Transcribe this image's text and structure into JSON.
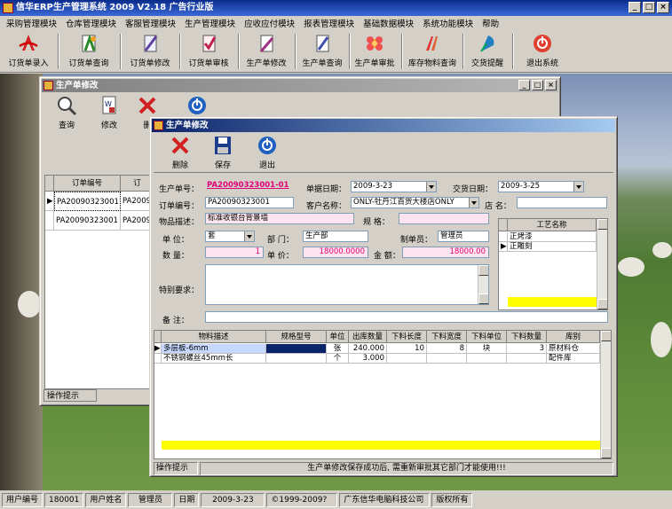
{
  "app": {
    "title": "信华ERP生产管理系统  2009  V2.18  广告行业版"
  },
  "menu": [
    "采购管理模块",
    "仓库管理模块",
    "客服管理模块",
    "生产管理模块",
    "应收应付模块",
    "报表管理模块",
    "基础数据模块",
    "系统功能模块",
    "帮助"
  ],
  "toolbar": [
    {
      "label": "订货单录入",
      "icon": "pdf-icon"
    },
    {
      "label": "订货单查询",
      "icon": "document-query-icon"
    },
    {
      "label": "订货单修改",
      "icon": "document-edit-icon"
    },
    {
      "label": "订货单审核",
      "icon": "document-audit-icon"
    },
    {
      "label": "生产单修改",
      "icon": "production-edit-icon"
    },
    {
      "label": "生产单查询",
      "icon": "production-query-icon"
    },
    {
      "label": "生产单审批",
      "icon": "flower-approve-icon"
    },
    {
      "label": "库存物料查询",
      "icon": "stock-query-icon"
    },
    {
      "label": "交货提醒",
      "icon": "delivery-reminder-icon"
    },
    {
      "label": "退出系统",
      "icon": "power-icon"
    }
  ],
  "back_window": {
    "title": "生产单修改",
    "buttons": {
      "query": "查询",
      "edit": "修改",
      "delete": "删"
    },
    "grid_header": "订单编号",
    "grid_header2": "订",
    "rows": [
      {
        "a": "PA20090323001",
        "b": "PA200903"
      },
      {
        "a": "PA20090323001",
        "b": "PA200903"
      }
    ],
    "footer": "操作提示"
  },
  "front_window": {
    "title": "生产单修改",
    "buttons": {
      "delete": "删除",
      "save": "保存",
      "exit": "退出"
    },
    "labels": {
      "prod_no": "生产单号：",
      "doc_date": "单据日期：",
      "delivery_date": "交货日期：",
      "order_no": "订单编号：",
      "customer": "客户名称：",
      "shop": "店  名：",
      "desc": "物品描述：",
      "spec": "规  格：",
      "unit": "单  位：",
      "dept": "部  门：",
      "maker": "制单员：",
      "qty": "数  量：",
      "price": "单  价：",
      "amount": "金  额：",
      "special": "特别要求：",
      "remark": "备  注："
    },
    "values": {
      "prod_no": "PA20090323001-01",
      "doc_date": "2009-3-23",
      "delivery_date": "2009-3-25",
      "order_no": "PA20090323001",
      "customer": "ONLY-牡丹江百货大楼店ONLY",
      "shop": "",
      "desc": "标准收银台背景墙",
      "spec": "",
      "unit": "套",
      "dept": "生产部",
      "maker": "管理员",
      "qty": "1",
      "price": "18000.0000",
      "amount": "18000.00"
    },
    "process": {
      "header": "工艺名称",
      "items": [
        "正烤漆",
        "正雕刻"
      ]
    },
    "materials": {
      "headers": [
        "物料描述",
        "规格型号",
        "单位",
        "出库数量",
        "下料长度",
        "下料宽度",
        "下料单位",
        "下料数量",
        "库别"
      ],
      "rows": [
        [
          "多层板-6mm",
          "",
          "张",
          "240.000",
          "10",
          "8",
          "块",
          "3",
          "原材料仓"
        ],
        [
          "不锈钢螺丝45mm长",
          "",
          "个",
          "3.000",
          "",
          "",
          "",
          "",
          "配件库"
        ]
      ]
    },
    "footer": {
      "label": "操作提示",
      "message": "生产单修改保存成功后, 需重新审批其它部门才能使用!!!"
    }
  },
  "status_bar": {
    "user_id_label": "用户编号",
    "user_id": "180001",
    "user_name_label": "用户姓名",
    "user_name": "管理员",
    "date_label": "日期",
    "date": "2009-3-23",
    "copyright": "©1999-2009?",
    "company": "广东信华电脑科技公司",
    "rights": "版权所有"
  },
  "colors": {
    "titlebar": "#0a246a",
    "pink_field": "#fde4ee",
    "grid_footer": "#ffff00",
    "link": "#e2007a"
  }
}
